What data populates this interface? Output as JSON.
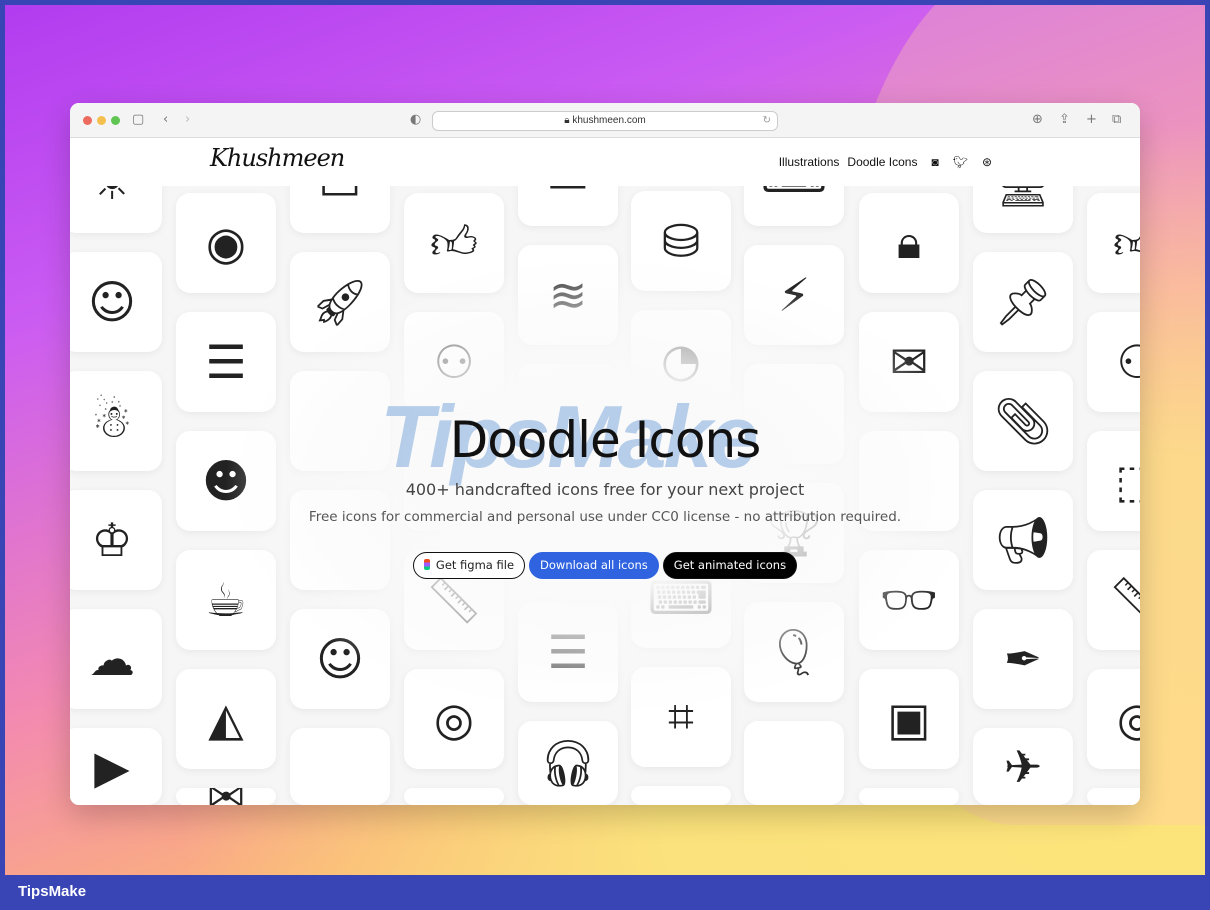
{
  "browser": {
    "url": "khushmeen.com",
    "traffic_lights": [
      "#ec6a5e",
      "#f4bf4f",
      "#61c554"
    ]
  },
  "site": {
    "logo": "Khushmeen",
    "nav": [
      "Illustrations",
      "Doodle Icons"
    ],
    "social_icons": [
      "instagram-icon",
      "twitter-icon",
      "dribbble-icon"
    ]
  },
  "hero": {
    "title": "Doodle Icons",
    "subtitle": "400+ handcrafted icons free for your next project",
    "description": "Free icons for commercial and personal use under CC0 license - no attribution required.",
    "buttons": {
      "figma": "Get figma file",
      "download": "Download all icons",
      "animated": "Get animated icons"
    },
    "accent": "#2f63e0"
  },
  "watermark": "TipsMake",
  "footer": {
    "brand": "TipsMake"
  },
  "icon_columns": [
    [
      "sun",
      "smiley",
      "snowman",
      "crown",
      "cloud-sun",
      "play"
    ],
    [
      "egg",
      "burger",
      "laugh",
      "coffee",
      "cake",
      "envelope-open"
    ],
    [
      "car",
      "rocket",
      "blank",
      "blank",
      "baby",
      "blank"
    ],
    [
      "thumbs-up",
      "sitemap",
      "blank",
      "ruler",
      "target",
      "blank"
    ],
    [
      "box",
      "layers",
      "blank",
      "blank",
      "server",
      "headphones"
    ],
    [
      "database",
      "cookie",
      "blank",
      "terminal",
      "crop",
      "blank"
    ],
    [
      "keyboard",
      "bolt",
      "blank",
      "trophy",
      "balloon",
      "blank"
    ],
    [
      "lock",
      "mail",
      "blank",
      "glasses",
      "chip",
      "blank"
    ],
    [
      "monitor",
      "pin",
      "paperclip",
      "megaphone",
      "pen",
      "paper-plane"
    ],
    [
      "thumbs-up",
      "sitemap",
      "vector",
      "ruler",
      "target",
      "blank"
    ]
  ]
}
